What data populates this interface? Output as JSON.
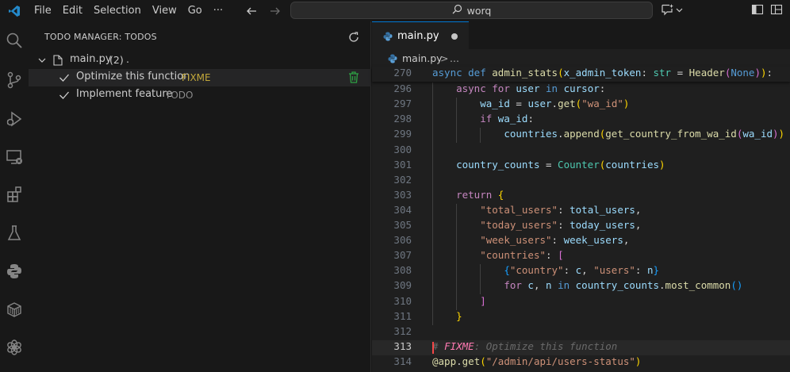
{
  "menu": [
    "File",
    "Edit",
    "Selection",
    "View",
    "Go",
    "···"
  ],
  "search": {
    "text": "worq"
  },
  "sidebar": {
    "header": "TODO MANAGER: TODOS",
    "file": {
      "name": "main.py",
      "badge": "(2)",
      "suffix": "."
    },
    "todos": [
      {
        "label": "Optimize this function",
        "tag": "FIXME",
        "tag_color": "#c2a73a",
        "selected": true
      },
      {
        "label": "Implement feature",
        "tag": "TODO",
        "tag_color": "#8b8b8b",
        "selected": false
      }
    ]
  },
  "editor": {
    "tab": {
      "label": "main.py",
      "modified": true
    },
    "breadcrumb": {
      "file": "main.py",
      "sep": ">",
      "more": "..."
    },
    "lines": [
      {
        "n": "270",
        "sticky": true,
        "tokens": [
          [
            "kw",
            "async "
          ],
          [
            "kw",
            "def "
          ],
          [
            "fn",
            "admin_stats"
          ],
          [
            "br1",
            "("
          ],
          [
            "var",
            "x_admin_token"
          ],
          [
            "pl",
            ": "
          ],
          [
            "typ",
            "str"
          ],
          [
            "pl",
            " = "
          ],
          [
            "fn",
            "Header"
          ],
          [
            "br2",
            "("
          ],
          [
            "kw",
            "None"
          ],
          [
            "br2",
            ")"
          ],
          [
            "br1",
            ")"
          ],
          [
            "pl",
            ":"
          ]
        ]
      },
      {
        "n": "296",
        "tokens": [
          [
            "pl",
            "    "
          ],
          [
            "ctl",
            "async "
          ],
          [
            "ctl",
            "for "
          ],
          [
            "var",
            "user "
          ],
          [
            "kw",
            "in "
          ],
          [
            "var",
            "cursor"
          ],
          [
            "pl",
            ":"
          ]
        ]
      },
      {
        "n": "297",
        "tokens": [
          [
            "pl",
            "        "
          ],
          [
            "var",
            "wa_id"
          ],
          [
            "pl",
            " = "
          ],
          [
            "var",
            "user"
          ],
          [
            "pl",
            "."
          ],
          [
            "fn",
            "get"
          ],
          [
            "br1",
            "("
          ],
          [
            "str",
            "\"wa_id\""
          ],
          [
            "br1",
            ")"
          ]
        ]
      },
      {
        "n": "298",
        "tokens": [
          [
            "pl",
            "        "
          ],
          [
            "ctl",
            "if "
          ],
          [
            "var",
            "wa_id"
          ],
          [
            "pl",
            ":"
          ]
        ]
      },
      {
        "n": "299",
        "tokens": [
          [
            "pl",
            "            "
          ],
          [
            "var",
            "countries"
          ],
          [
            "pl",
            "."
          ],
          [
            "fn",
            "append"
          ],
          [
            "br1",
            "("
          ],
          [
            "fn",
            "get_country_from_wa_id"
          ],
          [
            "br2",
            "("
          ],
          [
            "var",
            "wa_id"
          ],
          [
            "br2",
            ")"
          ],
          [
            "br1",
            ")"
          ]
        ]
      },
      {
        "n": "300",
        "tokens": []
      },
      {
        "n": "301",
        "tokens": [
          [
            "pl",
            "    "
          ],
          [
            "var",
            "country_counts"
          ],
          [
            "pl",
            " = "
          ],
          [
            "typ",
            "Counter"
          ],
          [
            "br1",
            "("
          ],
          [
            "var",
            "countries"
          ],
          [
            "br1",
            ")"
          ]
        ]
      },
      {
        "n": "302",
        "tokens": []
      },
      {
        "n": "303",
        "tokens": [
          [
            "pl",
            "    "
          ],
          [
            "ctl",
            "return "
          ],
          [
            "br1",
            "{"
          ]
        ]
      },
      {
        "n": "304",
        "tokens": [
          [
            "pl",
            "        "
          ],
          [
            "str",
            "\"total_users\""
          ],
          [
            "pl",
            ": "
          ],
          [
            "var",
            "total_users"
          ],
          [
            "pl",
            ","
          ]
        ]
      },
      {
        "n": "305",
        "tokens": [
          [
            "pl",
            "        "
          ],
          [
            "str",
            "\"today_users\""
          ],
          [
            "pl",
            ": "
          ],
          [
            "var",
            "today_users"
          ],
          [
            "pl",
            ","
          ]
        ]
      },
      {
        "n": "306",
        "tokens": [
          [
            "pl",
            "        "
          ],
          [
            "str",
            "\"week_users\""
          ],
          [
            "pl",
            ": "
          ],
          [
            "var",
            "week_users"
          ],
          [
            "pl",
            ","
          ]
        ]
      },
      {
        "n": "307",
        "tokens": [
          [
            "pl",
            "        "
          ],
          [
            "str",
            "\"countries\""
          ],
          [
            "pl",
            ": "
          ],
          [
            "br2",
            "["
          ]
        ]
      },
      {
        "n": "308",
        "tokens": [
          [
            "pl",
            "            "
          ],
          [
            "br3",
            "{"
          ],
          [
            "str",
            "\"country\""
          ],
          [
            "pl",
            ": "
          ],
          [
            "var",
            "c"
          ],
          [
            "pl",
            ", "
          ],
          [
            "str",
            "\"users\""
          ],
          [
            "pl",
            ": "
          ],
          [
            "var",
            "n"
          ],
          [
            "br3",
            "}"
          ]
        ]
      },
      {
        "n": "309",
        "tokens": [
          [
            "pl",
            "            "
          ],
          [
            "ctl",
            "for "
          ],
          [
            "var",
            "c"
          ],
          [
            "pl",
            ", "
          ],
          [
            "var",
            "n "
          ],
          [
            "kw",
            "in "
          ],
          [
            "var",
            "country_counts"
          ],
          [
            "pl",
            "."
          ],
          [
            "fn",
            "most_common"
          ],
          [
            "br3",
            "()"
          ]
        ]
      },
      {
        "n": "310",
        "tokens": [
          [
            "pl",
            "        "
          ],
          [
            "br2",
            "]"
          ]
        ]
      },
      {
        "n": "311",
        "tokens": [
          [
            "pl",
            "    "
          ],
          [
            "br1",
            "}"
          ]
        ]
      },
      {
        "n": "312",
        "tokens": []
      },
      {
        "n": "313",
        "current": true,
        "tokens": [
          [
            "cmt-rest",
            "# "
          ],
          [
            "cmt-fx",
            "FIXME"
          ],
          [
            "cmt-rest",
            ": Optimize this function"
          ]
        ]
      },
      {
        "n": "314",
        "tokens": [
          [
            "fn",
            "@app"
          ],
          [
            "pl",
            "."
          ],
          [
            "fn",
            "get"
          ],
          [
            "br1",
            "("
          ],
          [
            "str",
            "\"/admin/api/users-status\""
          ],
          [
            "br1",
            ")"
          ]
        ]
      }
    ]
  }
}
